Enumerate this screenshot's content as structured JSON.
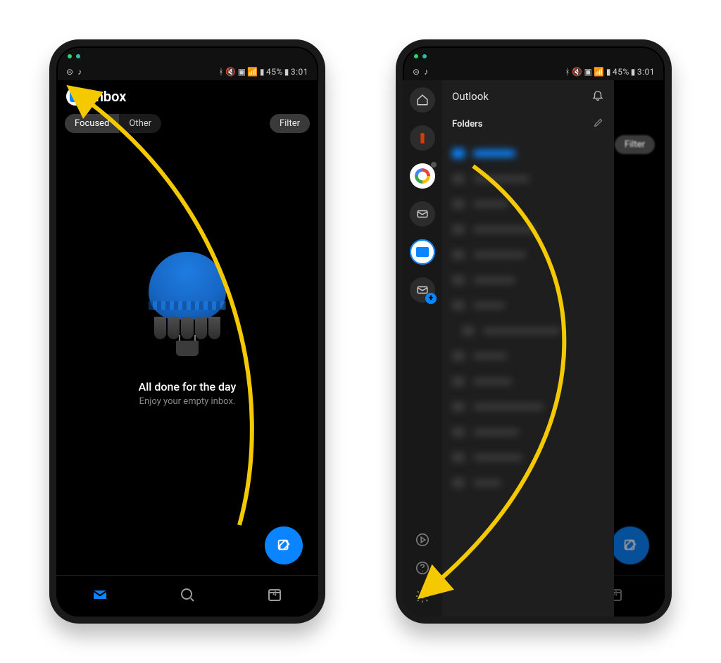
{
  "status": {
    "battery": "45%",
    "time": "3:01"
  },
  "phone1": {
    "title": "Inbox",
    "tab_focused": "Focused",
    "tab_other": "Other",
    "filter": "Filter",
    "empty_title": "All done for the day",
    "empty_sub": "Enjoy your empty inbox.",
    "calendar_day": "4"
  },
  "phone2": {
    "brand": "Outlook",
    "folders_label": "Folders",
    "filter": "Filter",
    "calendar_day": "4"
  }
}
